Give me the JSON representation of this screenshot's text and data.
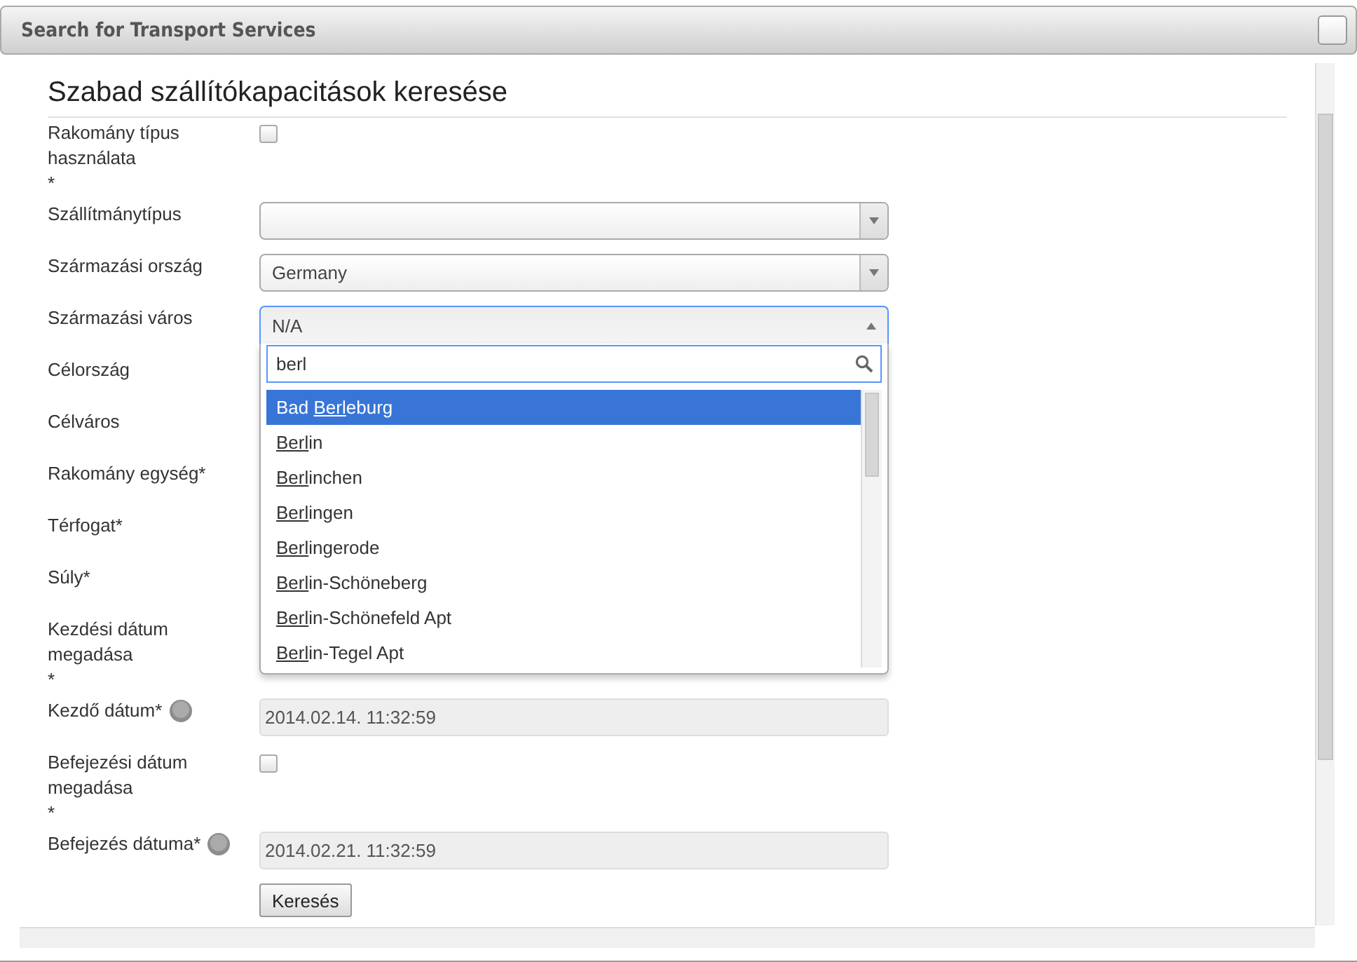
{
  "window": {
    "title": "Search for Transport Services"
  },
  "form": {
    "title": "Szabad szállítókapacitások keresése",
    "fields": [
      {
        "kind": "checkbox",
        "label": "Rakomány típus használata",
        "required_mark": "*",
        "checked": false
      },
      {
        "kind": "select",
        "label": "Szállítmánytípus"
      },
      {
        "kind": "select",
        "label": "Származási ország",
        "value": "Germany"
      },
      {
        "kind": "combo",
        "label": "Származási város",
        "value": "N/A",
        "expanded": true,
        "search": "berl",
        "options": [
          {
            "before": "Bad ",
            "match": "Berl",
            "after": "eburg",
            "selected": true
          },
          {
            "match": "Berl",
            "after": "in",
            "selected": false
          },
          {
            "match": "Berl",
            "after": "inchen",
            "selected": false
          },
          {
            "match": "Berl",
            "after": "ingen",
            "selected": false
          },
          {
            "match": "Berl",
            "after": "ingerode",
            "selected": false
          },
          {
            "match": "Berl",
            "after": "in-Schöneberg",
            "selected": false
          },
          {
            "match": "Berl",
            "after": "in-Schönefeld Apt",
            "selected": false
          },
          {
            "match": "Berl",
            "after": "in-Tegel Apt",
            "selected": false
          }
        ]
      },
      {
        "kind": "covered",
        "label": "Célország"
      },
      {
        "kind": "covered",
        "label": "Célváros"
      },
      {
        "kind": "covered",
        "label": "Rakomány egység*"
      },
      {
        "kind": "covered",
        "label": "Térfogat*"
      },
      {
        "kind": "covered",
        "label": "Súly*"
      },
      {
        "kind": "covered",
        "label": "Kezdési dátum megadása",
        "required_mark": "*"
      },
      {
        "kind": "date",
        "label": "Kezdő dátum*",
        "help": true,
        "value": "2014.02.14. 11:32:59",
        "disabled": true
      },
      {
        "kind": "checkbox",
        "label": "Befejezési dátum megadása",
        "required_mark": "*",
        "checked": false
      },
      {
        "kind": "date",
        "label": "Befejezés dátuma*",
        "help": true,
        "value": "2014.02.21. 11:32:59",
        "disabled": true
      }
    ],
    "submit": "Keresés"
  }
}
